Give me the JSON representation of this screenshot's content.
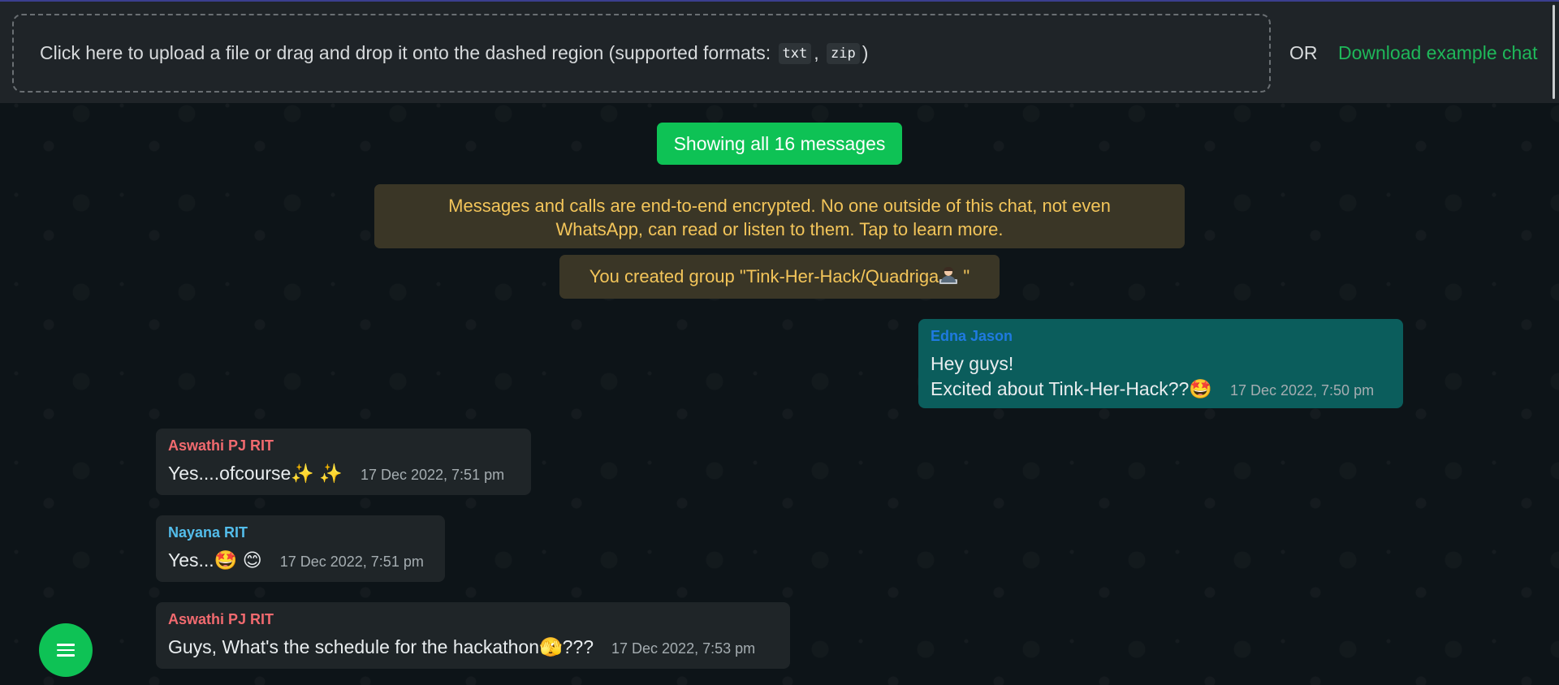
{
  "upload": {
    "prompt": "Click here to upload a file or drag and drop it onto the dashed region (supported formats:",
    "format_txt": "txt",
    "format_sep": ",",
    "format_zip": "zip",
    "close_paren": ")",
    "or_label": "OR",
    "download_label": "Download example chat"
  },
  "chat": {
    "count_label": "Showing all 16 messages",
    "encryption_notice": "Messages and calls are end-to-end encrypted. No one outside of this chat, not even WhatsApp, can read or listen to them. Tap to learn more.",
    "group_created_prefix": "You created group \"Tink-Her-Hack/Quadriga",
    "group_created_suffix": " \"",
    "messages": [
      {
        "sender": "Edna Jason",
        "sender_color": "#1f7ae0",
        "line1": "Hey guys!",
        "line2": "Excited about Tink-Her-Hack??",
        "emoji": "🤩",
        "time": "17 Dec 2022, 7:50 pm",
        "direction": "outgoing"
      },
      {
        "sender": "Aswathi PJ RIT",
        "sender_color": "#f16a6f",
        "text": "Yes....ofcourse ",
        "emoji": "✨ ✨",
        "time": "17 Dec 2022, 7:51 pm",
        "direction": "incoming"
      },
      {
        "sender": "Nayana RIT",
        "sender_color": "#53bdeb",
        "text": "Yes...",
        "emoji": "🤩 😊",
        "time": "17 Dec 2022, 7:51 pm",
        "direction": "incoming"
      },
      {
        "sender": "Aswathi PJ RIT",
        "sender_color": "#f16a6f",
        "text": "Guys, What's the schedule for the hackathon",
        "emoji": "🫣",
        "text_after": "???",
        "time": "17 Dec 2022, 7:53 pm",
        "direction": "incoming"
      }
    ]
  },
  "icons": {
    "menu_fab": "hamburger-menu-icon",
    "group_avatar": "technologist-icon"
  },
  "colors": {
    "accent": "#0ec255",
    "link": "#1fb85a",
    "outgoing_bubble": "#0b5d5c",
    "incoming_bubble": "#1f2528",
    "system_note_bg": "#3a3626",
    "system_note_text": "#f3c55a"
  }
}
